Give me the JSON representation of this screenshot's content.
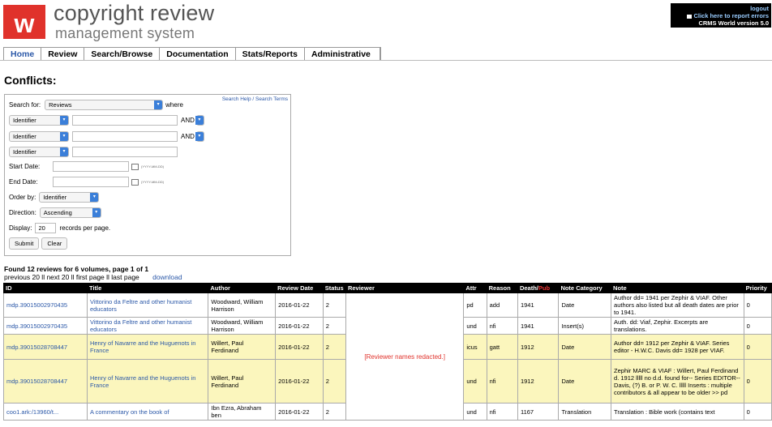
{
  "header": {
    "logo_letter": "w",
    "title": "copyright review",
    "subtitle": "management system",
    "logout": "logout",
    "report_errors": "Click here to report errors",
    "version": "CRMS World version 5.0"
  },
  "nav": [
    "Home",
    "Review",
    "Search/Browse",
    "Documentation",
    "Stats/Reports",
    "Administrative"
  ],
  "page_title": "Conflicts:",
  "search": {
    "help_link": "Search Help / Search Terms",
    "search_for_label": "Search for:",
    "search_for_value": "Reviews",
    "where": "where",
    "field1": "Identifier",
    "field2": "Identifier",
    "field3": "Identifier",
    "and1": "AND",
    "and2": "AND",
    "start_date_label": "Start Date:",
    "end_date_label": "End Date:",
    "date_hint": "(YYYY-MM-DD)",
    "order_by_label": "Order by:",
    "order_by_value": "Identifier",
    "direction_label": "Direction:",
    "direction_value": "Ascending",
    "display_label": "Display:",
    "display_value": "20",
    "per_page": "records per page.",
    "submit": "Submit",
    "clear": "Clear"
  },
  "results": {
    "found": "Found 12 reviews for 6 volumes, page 1 of 1",
    "pager": "previous 20  ll  next 20  ll  first page  ll  last page",
    "download": "download",
    "reviewer_note": "[Reviewer names redacted.]",
    "headers": [
      "ID",
      "Title",
      "Author",
      "Review Date",
      "Status",
      "Reviewer",
      "Attr",
      "Reason",
      "Death/",
      "Pub",
      "Note Category",
      "Note",
      "Priority"
    ],
    "rows": [
      {
        "id": "mdp.39015002970435",
        "title": "Vittorino da Feltre and other humanist educators",
        "author": "Woodward, William Harrison",
        "date": "2016-01-22",
        "status": "2",
        "attr": "pd",
        "reason": "add",
        "death": "1941",
        "category": "Date",
        "note": "Author dd= 1941 per Zephir & VIAF. Other authors also listed but all death dates are prior to 1941.",
        "priority": "0",
        "yellow": false
      },
      {
        "id": "mdp.39015002970435",
        "title": "Vittorino da Feltre and other humanist educators",
        "author": "Woodward, William Harrison",
        "date": "2016-01-22",
        "status": "2",
        "attr": "und",
        "reason": "nfi",
        "death": "1941",
        "category": "Insert(s)",
        "note": "Auth. dd: Viaf, Zephir. Excerpts are translations.",
        "priority": "0",
        "yellow": false
      },
      {
        "id": "mdp.39015028708447",
        "title": "Henry of Navarre and the Huguenots in France",
        "author": "Willert, Paul Ferdinand",
        "date": "2016-01-22",
        "status": "2",
        "attr": "icus",
        "reason": "gatt",
        "death": "1912",
        "category": "Date",
        "note": "Author dd= 1912 per Zephir & VIAF. Series editor - H.W.C. Davis dd= 1928 per VIAF.",
        "priority": "0",
        "yellow": true
      },
      {
        "id": "mdp.39015028708447",
        "title": "Henry of Navarre and the Huguenots in France",
        "author": "Willert, Paul Ferdinand",
        "date": "2016-01-22",
        "status": "2",
        "attr": "und",
        "reason": "nfi",
        "death": "1912",
        "category": "Date",
        "note": "Zephir MARC & VIAF : Willert, Paul Ferdinand d. 1912 lllll no d.d. found for-- Series EDITOR-- Davis, (?) B. or P. W. C. lllll Inserts : multiple contributors & all appear to be older >> pd",
        "priority": "0",
        "yellow": true
      },
      {
        "id": "coo1.ark:/13960/t...",
        "title": "A commentary on the book of",
        "author": "Ibn Ezra, Abraham ben",
        "date": "2016-01-22",
        "status": "2",
        "attr": "und",
        "reason": "nfi",
        "death": "1167",
        "category": "Translation",
        "note": "Translation : Bible work (contains text",
        "priority": "0",
        "yellow": false
      }
    ]
  }
}
